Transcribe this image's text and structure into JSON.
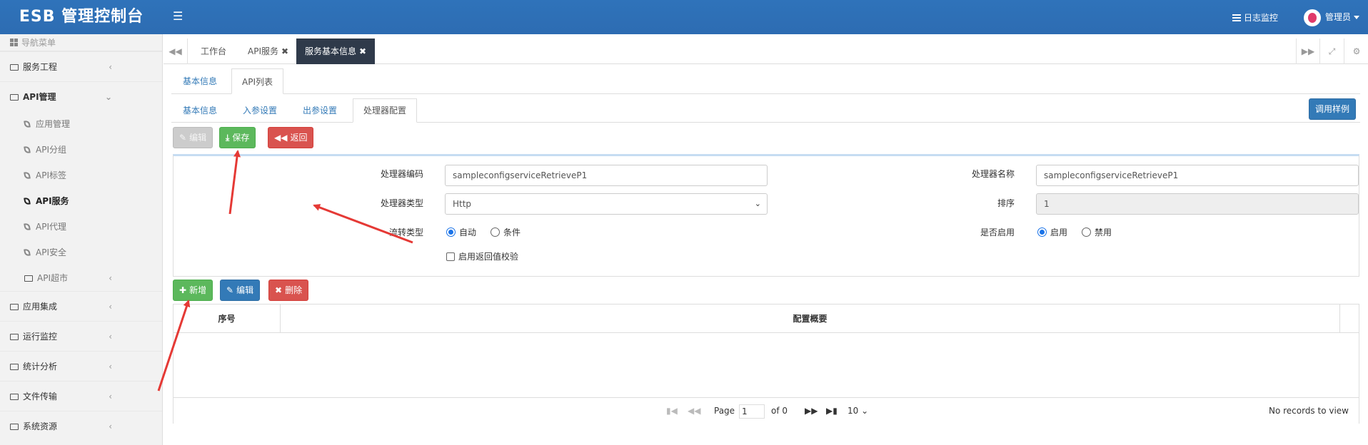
{
  "header": {
    "brand": "ESB 管理控制台",
    "log_link": "日志监控",
    "user": "管理员"
  },
  "sidebar": {
    "title": "导航菜单",
    "items": [
      {
        "label": "服务工程"
      },
      {
        "label": "API管理"
      },
      {
        "label": "应用管理"
      },
      {
        "label": "API分组"
      },
      {
        "label": "API标签"
      },
      {
        "label": "API服务"
      },
      {
        "label": "API代理"
      },
      {
        "label": "API安全"
      },
      {
        "label": "API超市"
      },
      {
        "label": "应用集成"
      },
      {
        "label": "运行监控"
      },
      {
        "label": "统计分析"
      },
      {
        "label": "文件传输"
      },
      {
        "label": "系统资源"
      }
    ]
  },
  "page_tabs": [
    {
      "label": "工作台"
    },
    {
      "label": "API服务"
    },
    {
      "label": "服务基本信息"
    }
  ],
  "level1_tabs": [
    {
      "label": "基本信息"
    },
    {
      "label": "API列表"
    }
  ],
  "level2_tabs": [
    {
      "label": "基本信息"
    },
    {
      "label": "入参设置"
    },
    {
      "label": "出参设置"
    },
    {
      "label": "处理器配置"
    }
  ],
  "toolbar": {
    "edit": "编辑",
    "save": "保存",
    "back": "返回",
    "example": "调用样例"
  },
  "form": {
    "code_label": "处理器编码",
    "code_value": "sampleconfigserviceRetrieveP1",
    "name_label": "处理器名称",
    "name_value": "sampleconfigserviceRetrieveP1",
    "type_label": "处理器类型",
    "type_value": "Http",
    "order_label": "排序",
    "order_value": "1",
    "flow_label": "流转类型",
    "flow_auto": "自动",
    "flow_cond": "条件",
    "enable_label": "是否启用",
    "enable_on": "启用",
    "enable_off": "禁用",
    "validate_label": "启用返回值校验"
  },
  "grid_toolbar": {
    "add": "新增",
    "edit": "编辑",
    "delete": "删除"
  },
  "grid": {
    "columns": [
      "序号",
      "配置概要"
    ],
    "pager": {
      "page_label": "Page",
      "page_value": "1",
      "of_label": "of 0",
      "page_size": "10",
      "status": "No records to view"
    }
  }
}
